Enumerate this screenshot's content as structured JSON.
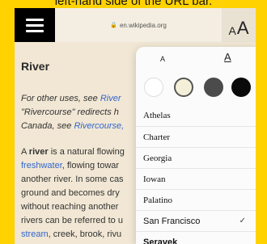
{
  "caption": "left-hand side of the URL bar.",
  "browser": {
    "url": "en.wikipedia.org",
    "text_size_icon_small": "A",
    "text_size_icon_large": "A"
  },
  "article": {
    "title": "River",
    "hatnote_lines": [
      [
        "For other uses, see ",
        "River",
        ""
      ],
      [
        "\"Rivercourse\" redirects h",
        "",
        ""
      ],
      [
        "Canada, see ",
        "Rivercourse,",
        ""
      ]
    ],
    "body_lines": [
      [
        "A ",
        "river",
        " is a natural flowing"
      ],
      [
        "",
        "freshwater",
        ", flowing towar"
      ],
      [
        "another river. In some cas",
        "",
        ""
      ],
      [
        "ground and becomes dry",
        "",
        ""
      ],
      [
        "without reaching another",
        "",
        ""
      ],
      [
        "rivers can be referred to u",
        "",
        ""
      ],
      [
        "",
        "stream",
        ", creek, brook, rivu"
      ]
    ]
  },
  "reader_settings": {
    "size_small": "A",
    "size_large": "A",
    "themes": [
      "white",
      "sepia",
      "gray",
      "black"
    ],
    "selected_theme": "sepia",
    "fonts": [
      "Athelas",
      "Charter",
      "Georgia",
      "Iowan",
      "Palatino",
      "San Francisco",
      "Seravek"
    ],
    "selected_font": "San Francisco",
    "check_mark": "✓"
  },
  "colors": {
    "background": "#ffd200",
    "link": "#3366cc",
    "page": "#f1e7d4"
  }
}
